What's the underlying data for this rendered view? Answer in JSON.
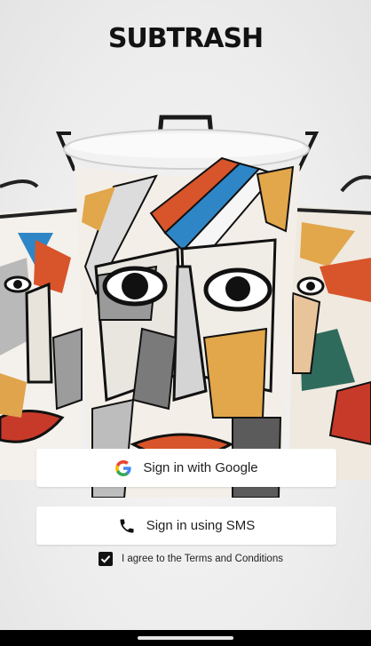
{
  "app": {
    "title": "SUBTRASH"
  },
  "auth": {
    "google_label": "Sign in with Google",
    "sms_label": "Sign in using SMS",
    "google_icon": "google-g-icon",
    "sms_icon": "phone-icon"
  },
  "terms": {
    "label": "I agree to the Terms and Conditions",
    "checked": true
  },
  "hero": {
    "subject": "three cubist-painted trash cans"
  },
  "colors": {
    "accent_blue": "#2f86c6",
    "accent_red": "#d8542a",
    "accent_yellow": "#e2a64b",
    "button_bg": "#ffffff",
    "checkbox": "#111111"
  }
}
